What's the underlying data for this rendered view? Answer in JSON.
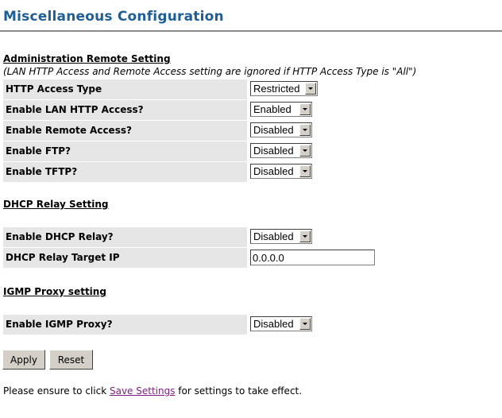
{
  "page": {
    "title": "Miscellaneous Configuration"
  },
  "admin": {
    "heading": "Administration Remote Setting",
    "note": "(LAN HTTP Access and Remote Access setting are ignored if HTTP Access Type is \"All\")",
    "rows": [
      {
        "label": "HTTP Access Type",
        "value": "Restricted"
      },
      {
        "label": "Enable LAN HTTP Access?",
        "value": "Enabled"
      },
      {
        "label": "Enable Remote Access?",
        "value": "Disabled"
      },
      {
        "label": "Enable FTP?",
        "value": "Disabled"
      },
      {
        "label": "Enable TFTP?",
        "value": "Disabled"
      }
    ]
  },
  "dhcp": {
    "heading": "DHCP Relay Setting",
    "rows": [
      {
        "label": "Enable DHCP Relay?",
        "value": "Disabled"
      },
      {
        "label": "DHCP Relay Target IP",
        "value": "0.0.0.0"
      }
    ]
  },
  "igmp": {
    "heading": "IGMP Proxy setting",
    "rows": [
      {
        "label": "Enable IGMP Proxy?",
        "value": "Disabled"
      }
    ]
  },
  "buttons": {
    "apply": "Apply",
    "reset": "Reset"
  },
  "footer": {
    "prefix": "Please ensure to click ",
    "link": "Save Settings",
    "suffix": " for settings to take effect."
  },
  "colors": {
    "title": "#1f5f96",
    "label_bg": "#e6e6e6",
    "link": "#7a1f7a"
  }
}
